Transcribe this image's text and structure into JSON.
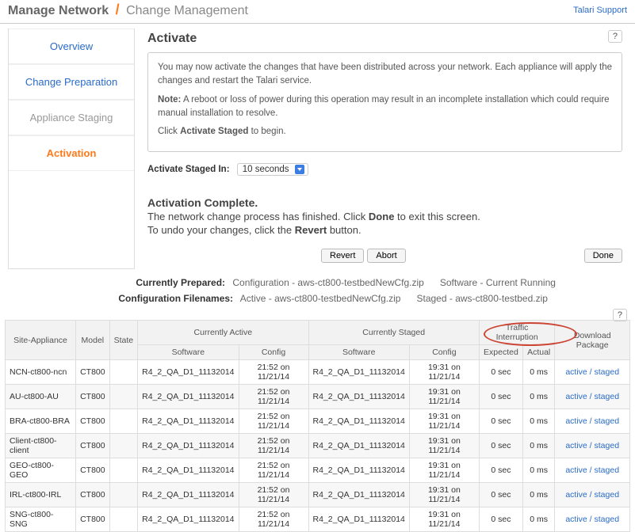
{
  "header": {
    "breadcrumb_root": "Manage Network",
    "breadcrumb_current": "Change Management",
    "support_link": "Talari Support"
  },
  "sidebar": {
    "tabs": {
      "overview": "Overview",
      "change_prep": "Change Preparation",
      "appliance_staging": "Appliance Staging",
      "activation": "Activation"
    }
  },
  "content": {
    "title": "Activate",
    "help": "?",
    "info_p1": "You may now activate the changes that have been distributed across your network. Each appliance will apply the changes and restart the Talari service.",
    "info_note_label": "Note:",
    "info_note_text": " A reboot or loss of power during this operation may result in an incomplete installation which could require manual installation to resolve.",
    "info_p3_pre": "Click ",
    "info_p3_bold": "Activate Staged",
    "info_p3_post": " to begin.",
    "activate_label": "Activate Staged In:",
    "activate_value": "10 seconds",
    "status_title": "Activation Complete.",
    "status_line1_pre": "The network change process has finished. Click ",
    "status_line1_bold": "Done",
    "status_line1_post": " to exit this screen.",
    "status_line2_pre": "To undo your changes, click the ",
    "status_line2_bold": "Revert",
    "status_line2_post": " button.",
    "btn_revert": "Revert",
    "btn_abort": "Abort",
    "btn_done": "Done"
  },
  "meta": {
    "prepared_label": "Currently Prepared:",
    "prepared_config": "Configuration - aws-ct800-testbedNewCfg.zip",
    "prepared_software": "Software - Current Running",
    "filenames_label": "Configuration Filenames:",
    "filenames_active": "Active - aws-ct800-testbedNewCfg.zip",
    "filenames_staged": "Staged - aws-ct800-testbed.zip"
  },
  "table": {
    "headers": {
      "site": "Site-Appliance",
      "model": "Model",
      "state": "State",
      "active_group": "Currently Active",
      "staged_group": "Currently Staged",
      "traffic_group": "Traffic Interruption",
      "download": "Download Package",
      "software": "Software",
      "config": "Config",
      "expected": "Expected",
      "actual": "Actual"
    },
    "rows": [
      {
        "site": "NCN-ct800-ncn",
        "model": "CT800",
        "state": "",
        "a_sw": "R4_2_QA_D1_11132014",
        "a_cfg": "21:52 on 11/21/14",
        "s_sw": "R4_2_QA_D1_11132014",
        "s_cfg": "19:31 on 11/21/14",
        "exp": "0 sec",
        "act": "0 ms",
        "dl": "active / staged"
      },
      {
        "site": "AU-ct800-AU",
        "model": "CT800",
        "state": "",
        "a_sw": "R4_2_QA_D1_11132014",
        "a_cfg": "21:52 on 11/21/14",
        "s_sw": "R4_2_QA_D1_11132014",
        "s_cfg": "19:31 on 11/21/14",
        "exp": "0 sec",
        "act": "0 ms",
        "dl": "active / staged"
      },
      {
        "site": "BRA-ct800-BRA",
        "model": "CT800",
        "state": "",
        "a_sw": "R4_2_QA_D1_11132014",
        "a_cfg": "21:52 on 11/21/14",
        "s_sw": "R4_2_QA_D1_11132014",
        "s_cfg": "19:31 on 11/21/14",
        "exp": "0 sec",
        "act": "0 ms",
        "dl": "active / staged"
      },
      {
        "site": "Client-ct800-client",
        "model": "CT800",
        "state": "",
        "a_sw": "R4_2_QA_D1_11132014",
        "a_cfg": "21:52 on 11/21/14",
        "s_sw": "R4_2_QA_D1_11132014",
        "s_cfg": "19:31 on 11/21/14",
        "exp": "0 sec",
        "act": "0 ms",
        "dl": "active / staged"
      },
      {
        "site": "GEO-ct800-GEO",
        "model": "CT800",
        "state": "",
        "a_sw": "R4_2_QA_D1_11132014",
        "a_cfg": "21:52 on 11/21/14",
        "s_sw": "R4_2_QA_D1_11132014",
        "s_cfg": "19:31 on 11/21/14",
        "exp": "0 sec",
        "act": "0 ms",
        "dl": "active / staged"
      },
      {
        "site": "IRL-ct800-IRL",
        "model": "CT800",
        "state": "",
        "a_sw": "R4_2_QA_D1_11132014",
        "a_cfg": "21:52 on 11/21/14",
        "s_sw": "R4_2_QA_D1_11132014",
        "s_cfg": "19:31 on 11/21/14",
        "exp": "0 sec",
        "act": "0 ms",
        "dl": "active / staged"
      },
      {
        "site": "SNG-ct800-SNG",
        "model": "CT800",
        "state": "",
        "a_sw": "R4_2_QA_D1_11132014",
        "a_cfg": "21:52 on 11/21/14",
        "s_sw": "R4_2_QA_D1_11132014",
        "s_cfg": "19:31 on 11/21/14",
        "exp": "0 sec",
        "act": "0 ms",
        "dl": "active / staged"
      }
    ]
  }
}
